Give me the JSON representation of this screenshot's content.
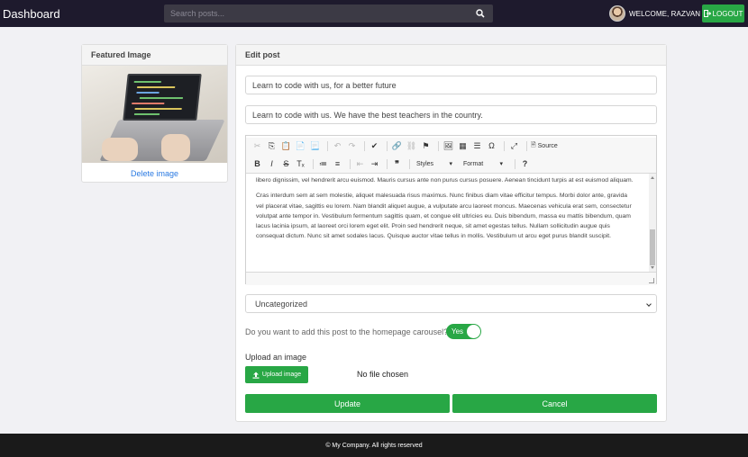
{
  "navbar": {
    "brand": "Dashboard",
    "search_placeholder": "Search posts...",
    "welcome": "WELCOME, RAZVAN",
    "logout_label": "LOGOUT"
  },
  "featured": {
    "title": "Featured Image",
    "delete_label": "Delete image"
  },
  "edit": {
    "title": "Edit post",
    "post_title": "Learn to code with us, for a better future",
    "post_subtitle": "Learn to code with us. We have the best teachers in the country.",
    "toolbar": {
      "source_label": "Source",
      "styles_label": "Styles",
      "format_label": "Format"
    },
    "content": {
      "paragraph1": "libero dignissim, vel hendrerit arcu euismod. Mauris cursus ante non purus cursus posuere. Aenean tincidunt turpis at est euismod aliquam.",
      "paragraph2": "Cras interdum sem at sem molestie, aliquet malesuada risus maximus. Nunc finibus diam vitae efficitur tempus. Morbi dolor ante, gravida vel placerat vitae, sagittis eu lorem. Nam blandit aliquet augue, a vulputate arcu laoreet moncus. Maecenas vehicula erat sem, consectetur volutpat ante tempor in. Vestibulum fermentum sagittis quam, et congue elit ultricies eu. Duis bibendum, massa eu mattis bibendum, quam lacus lacinia ipsum, at laoreet orci lorem eget elit. Proin sed hendrerit neque, sit amet egestas tellus. Nullam sollicitudin augue quis consequat dictum. Nunc sit amet sodales lacus. Quisque auctor vitae tellus in mollis. Vestibulum ut arcu eget purus blandit suscipit."
    },
    "category": "Uncategorized",
    "carousel_question": "Do you want to add this post to the homepage carousel?",
    "carousel_toggle": "Yes",
    "upload_label": "Upload an image",
    "upload_button": "Upload image",
    "no_file": "No file chosen",
    "update_label": "Update",
    "cancel_label": "Cancel"
  },
  "footer": {
    "text": "© My Company. All rights reserved"
  },
  "colors": {
    "navbar": "#1e1a2d",
    "accent_green": "#28a745",
    "link_blue": "#2a7ae2",
    "footer": "#1a1a1a"
  }
}
